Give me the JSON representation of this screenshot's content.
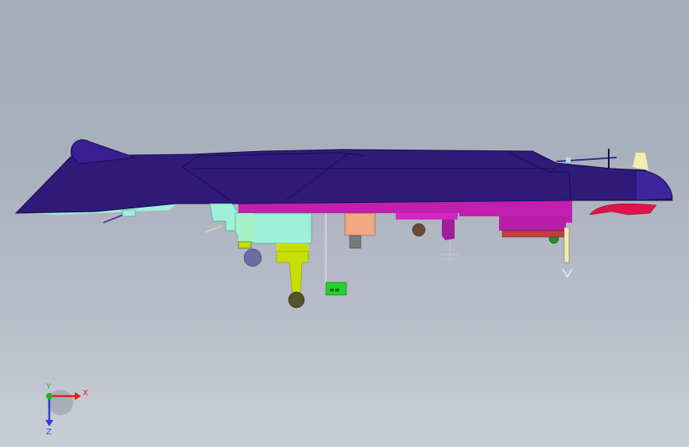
{
  "viewport": {
    "background_top": "#a6aebb",
    "background_bottom": "#c9ced6"
  },
  "model": {
    "name": "",
    "colors": {
      "hull": "#2f1a7a",
      "hull_dark": "#1e0f5c",
      "underside": "#c21fb0",
      "mint": "#9ef0d9",
      "lime": "#c8e000",
      "salmon": "#f2a884",
      "cream": "#f2edb0",
      "green_tag": "#25d12b",
      "red_part": "#e0144a"
    },
    "tag_text": "≡≡"
  },
  "triad": {
    "x_label": "X",
    "y_label": "Y",
    "z_label": "Z",
    "x_color": "#e0201a",
    "y_color": "#1fb52a",
    "z_color": "#2a3fd6"
  }
}
